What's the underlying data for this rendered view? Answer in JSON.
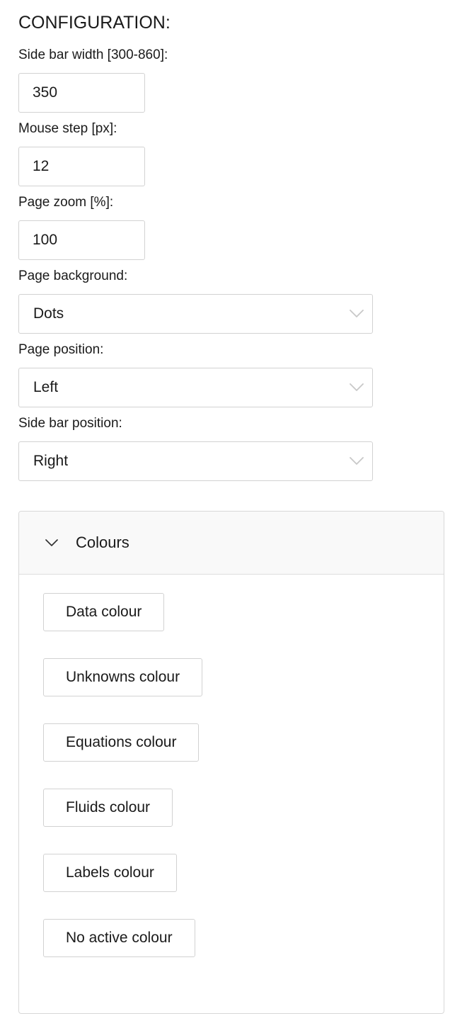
{
  "title": "CONFIGURATION:",
  "fields": [
    {
      "label": "Side bar width [300-860]:",
      "type": "text",
      "value": "350",
      "name": "side-bar-width"
    },
    {
      "label": "Mouse step [px]:",
      "type": "text",
      "value": "12",
      "name": "mouse-step"
    },
    {
      "label": "Page zoom [%]:",
      "type": "text",
      "value": "100",
      "name": "page-zoom"
    },
    {
      "label": "Page background:",
      "type": "select",
      "value": "Dots",
      "name": "page-background"
    },
    {
      "label": "Page position:",
      "type": "select",
      "value": "Left",
      "name": "page-position"
    },
    {
      "label": "Side bar position:",
      "type": "select",
      "value": "Right",
      "name": "side-bar-position"
    }
  ],
  "colours_panel": {
    "title": "Colours",
    "expanded": true,
    "chevron_icon": "chevron-down-icon",
    "buttons": [
      {
        "label": "Data colour",
        "name": "data-colour"
      },
      {
        "label": "Unknowns colour",
        "name": "unknowns-colour"
      },
      {
        "label": "Equations colour",
        "name": "equations-colour"
      },
      {
        "label": "Fluids colour",
        "name": "fluids-colour"
      },
      {
        "label": "Labels colour",
        "name": "labels-colour"
      },
      {
        "label": "No active colour",
        "name": "no-active-colour"
      }
    ]
  },
  "colors": {
    "text": "#1a1a1a",
    "border": "#d2d2d2",
    "panel_border": "#d8d8d8",
    "panel_header_bg": "#f9f9f9",
    "select_chevron": "#c8c8c8",
    "background": "#ffffff"
  }
}
